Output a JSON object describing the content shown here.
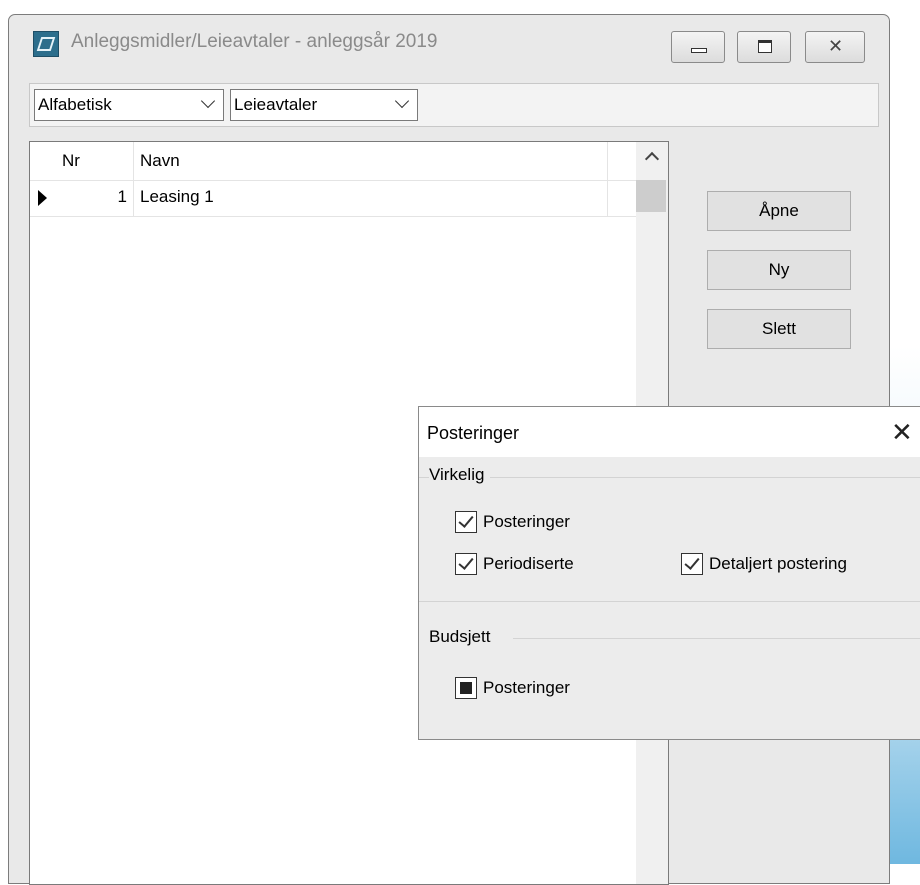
{
  "window": {
    "title": "Anleggsmidler/Leieavtaler - anleggsår 2019",
    "minimize_icon": "minimize-icon",
    "maximize_icon": "maximize-icon",
    "close_icon": "close-icon",
    "close_glyph": "✕"
  },
  "toolbar": {
    "sort_select": "Alfabetisk",
    "type_select": "Leieavtaler"
  },
  "grid": {
    "columns": [
      "Nr",
      "Navn"
    ],
    "rows": [
      {
        "nr": "1",
        "navn": "Leasing 1"
      }
    ]
  },
  "actions": {
    "open": "Åpne",
    "new": "Ny",
    "delete": "Slett"
  },
  "posting_dialog": {
    "title": "Posteringer",
    "close_glyph": "✕",
    "groups": [
      {
        "label": "Virkelig",
        "options": [
          {
            "label": "Posteringer",
            "state": "checked"
          },
          {
            "label": "Periodiserte",
            "state": "checked"
          },
          {
            "label": "Detaljert postering",
            "state": "checked"
          }
        ]
      },
      {
        "label": "Budsjett",
        "options": [
          {
            "label": "Posteringer",
            "state": "indeterminate"
          }
        ]
      }
    ]
  }
}
